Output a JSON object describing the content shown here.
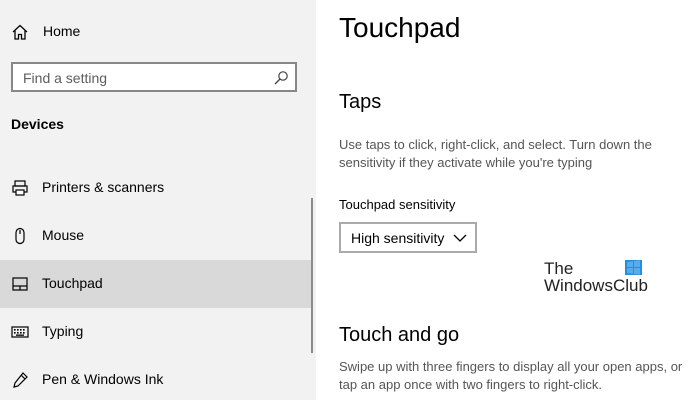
{
  "sidebar": {
    "home_label": "Home",
    "search_placeholder": "Find a setting",
    "section_title": "Devices",
    "items": [
      {
        "label": "Printers & scanners",
        "icon": "printer-icon",
        "selected": false
      },
      {
        "label": "Mouse",
        "icon": "mouse-icon",
        "selected": false
      },
      {
        "label": "Touchpad",
        "icon": "touchpad-icon",
        "selected": true
      },
      {
        "label": "Typing",
        "icon": "keyboard-icon",
        "selected": false
      },
      {
        "label": "Pen & Windows Ink",
        "icon": "pen-icon",
        "selected": false
      }
    ]
  },
  "main": {
    "page_title": "Touchpad",
    "taps": {
      "title": "Taps",
      "description": "Use taps to click, right-click, and select. Turn down the sensitivity if they activate while you're typing",
      "sensitivity_label": "Touchpad sensitivity",
      "sensitivity_value": "High sensitivity"
    },
    "touch_and_go": {
      "title": "Touch and go",
      "description": "Swipe up with three fingers to display all your open apps, or tap an app once with two fingers to right-click."
    }
  },
  "watermark": {
    "line1": "The",
    "line2": "WindowsClub",
    "logo_color": "#1e90e6"
  },
  "colors": {
    "sidebar_bg": "#f2f2f2",
    "selected_bg": "#d9d9d9",
    "description_text": "#555555"
  }
}
